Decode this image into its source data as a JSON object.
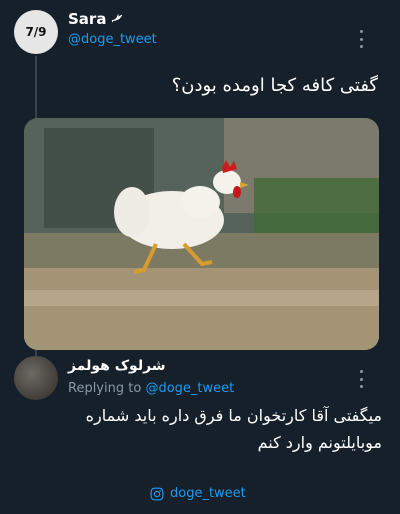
{
  "thread": {
    "counter": "7/9"
  },
  "tweet": {
    "display_name": "Sara",
    "handle": "@doge_tweet",
    "text": "گفتی کافه کجا اومده بودن؟"
  },
  "reply": {
    "display_name": "شرلوک هولمز",
    "replying_prefix": "Replying to ",
    "replying_handle": "@doge_tweet",
    "text": "میگفتی آقا کارتخوان ما فرق داره باید شماره موبایلتونم وارد کنم"
  },
  "footer": {
    "instagram_handle": "doge_tweet"
  },
  "colors": {
    "background": "#15202b",
    "accent": "#1d9bf0",
    "muted": "#8b98a5"
  }
}
